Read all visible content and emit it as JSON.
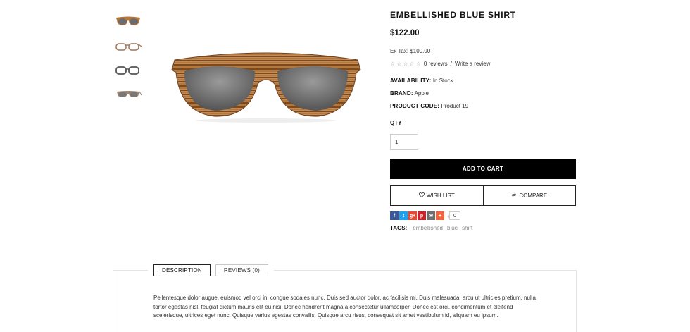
{
  "product": {
    "title": "EMBELLISHED BLUE SHIRT",
    "price": "$122.00",
    "ex_tax": "Ex Tax: $100.00",
    "rating": {
      "stars_filled": 0,
      "stars_total": 5,
      "reviews_link": "0 reviews",
      "separator": "/",
      "write_review_link": "Write a review"
    },
    "availability": {
      "label": "AVAILABILITY:",
      "value": "In Stock"
    },
    "brand": {
      "label": "BRAND:",
      "value": "Apple"
    },
    "code": {
      "label": "PRODUCT CODE:",
      "value": "Product 19"
    },
    "qty": {
      "label": "QTY",
      "value": "1"
    },
    "add_to_cart": "ADD TO CART",
    "wish_list": "WISH LIST",
    "compare": "COMPARE",
    "share": {
      "buttons": [
        {
          "icon": "facebook-icon",
          "glyph": "f",
          "color": "#3b5998"
        },
        {
          "icon": "twitter-icon",
          "glyph": "t",
          "color": "#1da1f2"
        },
        {
          "icon": "google-plus-icon",
          "glyph": "g+",
          "color": "#dd4b39"
        },
        {
          "icon": "pinterest-icon",
          "glyph": "p",
          "color": "#cb2027"
        },
        {
          "icon": "email-icon",
          "glyph": "✉",
          "color": "#6e6e6e"
        },
        {
          "icon": "add-more-icon",
          "glyph": "+",
          "color": "#f2643a"
        }
      ],
      "count": "0"
    },
    "tags": {
      "label": "TAGS:",
      "items": [
        "embellished",
        "blue",
        "shirt"
      ]
    }
  },
  "colors": {
    "accent": "#000000",
    "frame_wood": "#b8753a",
    "frame_wood_dark": "#6e4220",
    "lens": "#7c7c7c"
  },
  "tabs": [
    {
      "label": "DESCRIPTION",
      "active": true
    },
    {
      "label": "REVIEWS (0)",
      "active": false
    }
  ],
  "description": "Pellentesque dolor augue, euismod vel orci in, congue sodales nunc. Duis sed auctor dolor, ac facilisis mi. Duis malesuada, arcu ut ultricies pretium, nulla tortor egestas nisl, feugiat dictum mauris elit eu nisi. Donec hendrerit magna a consectetur ullamcorper. Donec est orci, condimentum et eleifend scelerisque, ultrices eget nunc. Quisque varius egestas convallis. Quisque arcu risus, consequat sit amet vestibulum id, aliquam eu ipsum."
}
